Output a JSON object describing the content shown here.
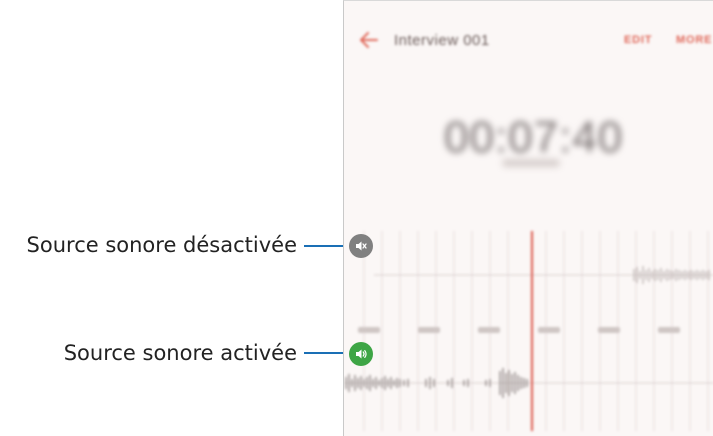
{
  "annotations": {
    "source_off": "Source sonore désactivée",
    "source_on": "Source sonore activée"
  },
  "app": {
    "title": "Interview 001",
    "edit_label": "EDIT",
    "more_label": "MORE",
    "timer": "00:07:40"
  },
  "colors": {
    "accent": "#e06a5c",
    "leader_line": "#1a6fb5",
    "source_on": "#3ea545",
    "source_off": "#808080",
    "playhead": "#d9564a"
  },
  "icons": {
    "back": "arrow-left-icon",
    "source_off": "speaker-muted-icon",
    "source_on": "speaker-on-icon"
  }
}
